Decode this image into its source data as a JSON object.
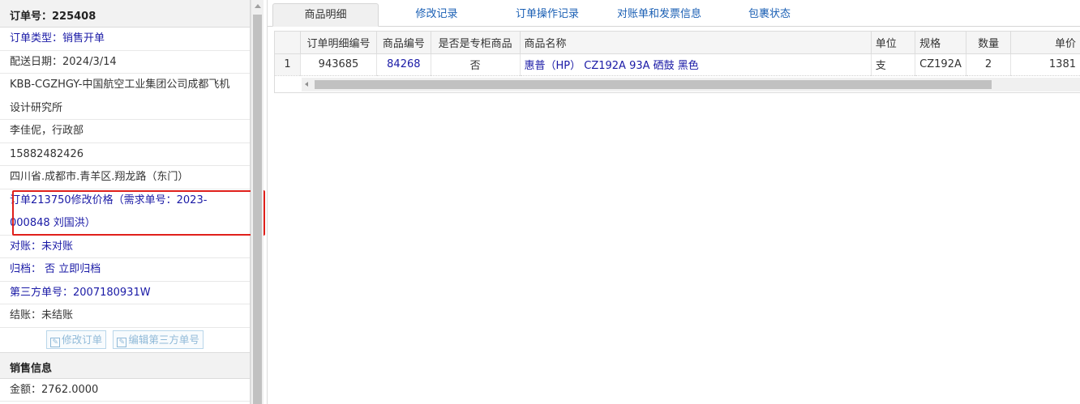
{
  "order": {
    "header": "订单号：225408",
    "rows": [
      {
        "text": "订单类型：销售开单",
        "link": true
      },
      {
        "text": "配送日期：2024/3/14",
        "link": false
      },
      {
        "text": "KBB-CGZHGY-中国航空工业集团公司成都飞机设计研究所",
        "link": false,
        "tall": true
      },
      {
        "text": "李佳伲，行政部",
        "link": false
      },
      {
        "text": "15882482426",
        "link": false
      },
      {
        "text": "四川省.成都市.青羊区.翔龙路（东门）",
        "link": false
      },
      {
        "text": "订单213750修改价格（需求单号：2023-000848 刘国洪）",
        "link": true,
        "tall": true
      },
      {
        "text": "对账：未对账",
        "link": true
      },
      {
        "text": "归档： 否 立即归档",
        "link": true
      },
      {
        "text": "第三方单号：2007180931W",
        "link": true
      },
      {
        "text": "结账：未结账",
        "link": false
      }
    ],
    "buttons": {
      "edit_order": "修改订单",
      "edit_third_party": "编辑第三方单号"
    },
    "sales_header": "销售信息",
    "amount": "金额：2762.0000"
  },
  "tabs": [
    "商品明细",
    "修改记录",
    "订单操作记录",
    "对账单和发票信息",
    "包裹状态"
  ],
  "active_tab": 0,
  "grid": {
    "columns": [
      "订单明细编号",
      "商品编号",
      "是否是专柜商品",
      "商品名称",
      "单位",
      "规格",
      "数量",
      "单价"
    ],
    "rows": [
      {
        "index": "1",
        "detail_id": "943685",
        "product_id": "84268",
        "is_counter": "否",
        "name": "惠普（HP） CZ192A 93A 硒鼓 黑色",
        "unit": "支",
        "spec": "CZ192A",
        "qty": "2",
        "price": "1381"
      }
    ]
  }
}
